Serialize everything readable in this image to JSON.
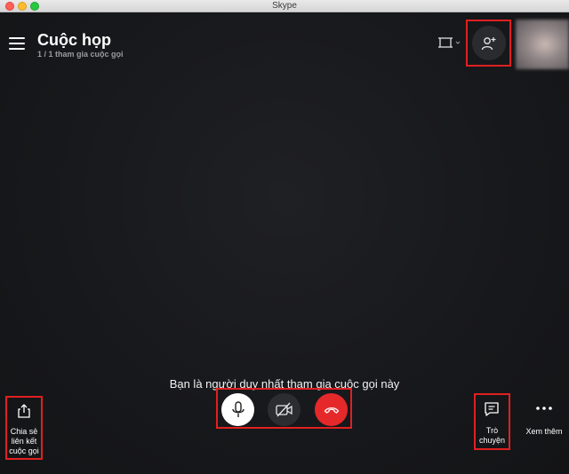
{
  "window": {
    "title": "Skype"
  },
  "header": {
    "title": "Cuộc họp",
    "subtitle": "1 / 1 tham gia cuộc gọi"
  },
  "call": {
    "notice": "Bạn là người duy nhất tham gia cuộc gọi này"
  },
  "actions": {
    "share_label": "Chia sẻ liên kết cuộc gọi",
    "chat_label": "Trò chuyện",
    "more_label": "Xem thêm"
  },
  "icons": {
    "menu": "hamburger-menu-icon",
    "layout": "layout-switch-icon",
    "add_person": "add-person-icon",
    "mic": "microphone-icon",
    "video_off": "video-off-icon",
    "end_call": "hang-up-icon",
    "share": "share-icon",
    "chat": "chat-icon",
    "more": "more-dots-icon"
  },
  "colors": {
    "background": "#151618",
    "end_call": "#e5292b",
    "highlight": "#e02020"
  }
}
